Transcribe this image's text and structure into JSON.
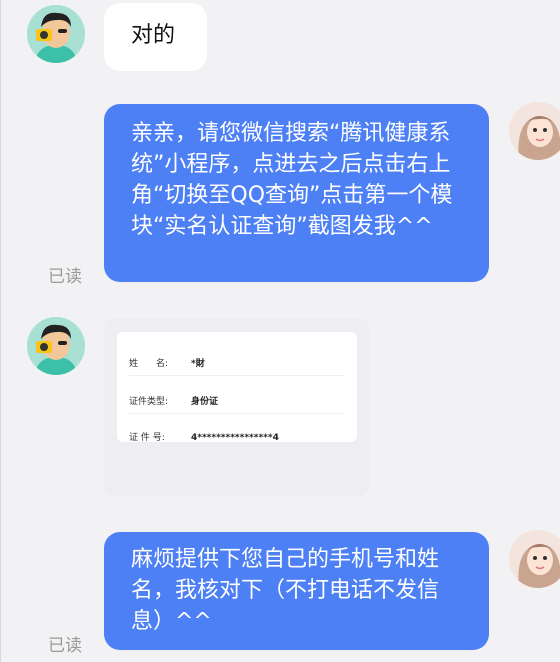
{
  "messages": [
    {
      "side": "left",
      "text": "对的"
    },
    {
      "side": "right",
      "text": "亲亲，请您微信搜索“腾讯健康系统”小程序，点进去之后点击右上角“切换至QQ查询”点击第一个模块“实名认证查询”截图发我^^",
      "status": "已读"
    },
    {
      "side": "left",
      "type": "image",
      "card": {
        "name_label": "姓　　名:",
        "name_value": "*財",
        "id_type_label": "证件类型:",
        "id_type_value": "身份证",
        "id_no_label": "证 件 号:",
        "id_no_value": "4****************4"
      }
    },
    {
      "side": "right",
      "text": "麻烦提供下您自己的手机号和姓名，我核对下（不打电话不发信息）^^",
      "status": "已读"
    }
  ],
  "colors": {
    "blue_bubble": "#4d7ff5",
    "white_bubble": "#ffffff",
    "background": "#f2f2f4"
  },
  "icons": {
    "avatar_left": "cartoon-man-avatar",
    "avatar_right": "woman-photo-avatar"
  }
}
